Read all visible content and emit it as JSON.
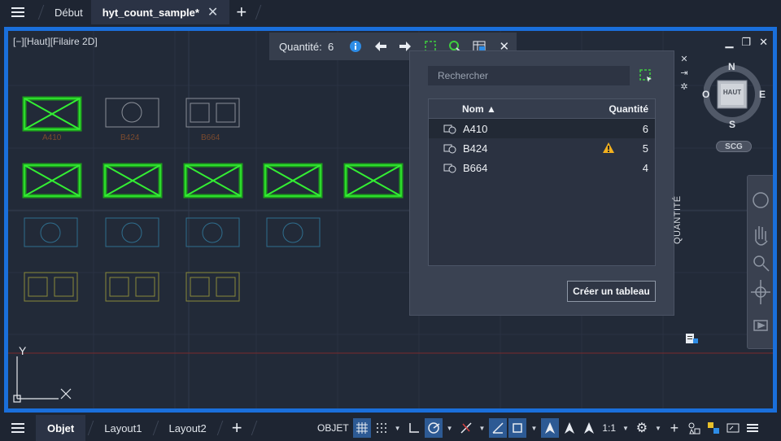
{
  "topbar": {
    "home_tab": "Début",
    "doc_tab": "hyt_count_sample*",
    "close_symbol": "✕",
    "new_symbol": "+"
  },
  "viewport": {
    "label": "[−][Haut][Filaire 2D]",
    "win_min": "▁",
    "win_restore": "❐",
    "win_close": "✕"
  },
  "count_toolbar": {
    "label": "Quantité:",
    "count": "6"
  },
  "blocks": {
    "row1_labels": [
      "A410",
      "B424",
      "B664"
    ]
  },
  "panel": {
    "search_placeholder": "Rechercher",
    "col_name": "Nom",
    "col_qty": "Quantité",
    "rows": [
      {
        "name": "A410",
        "qty": "6"
      },
      {
        "name": "B424",
        "qty": "5",
        "warning": true
      },
      {
        "name": "B664",
        "qty": "4"
      }
    ],
    "create_button": "Créer un tableau",
    "title": "QUANTITÉ"
  },
  "navcube": {
    "north": "N",
    "south": "S",
    "east": "E",
    "west": "O",
    "face": "HAUT",
    "ucs": "SCG"
  },
  "ucs_axis": {
    "y": "Y"
  },
  "bottombar": {
    "model_tab": "Objet",
    "layout1": "Layout1",
    "layout2": "Layout2",
    "new_symbol": "+",
    "objet_btn": "OBJET",
    "scale": "1:1"
  },
  "colors": {
    "accent": "#1a6fdb",
    "green": "#22dd22",
    "teal": "#2f6e8e",
    "olive": "#8a8a3a"
  }
}
